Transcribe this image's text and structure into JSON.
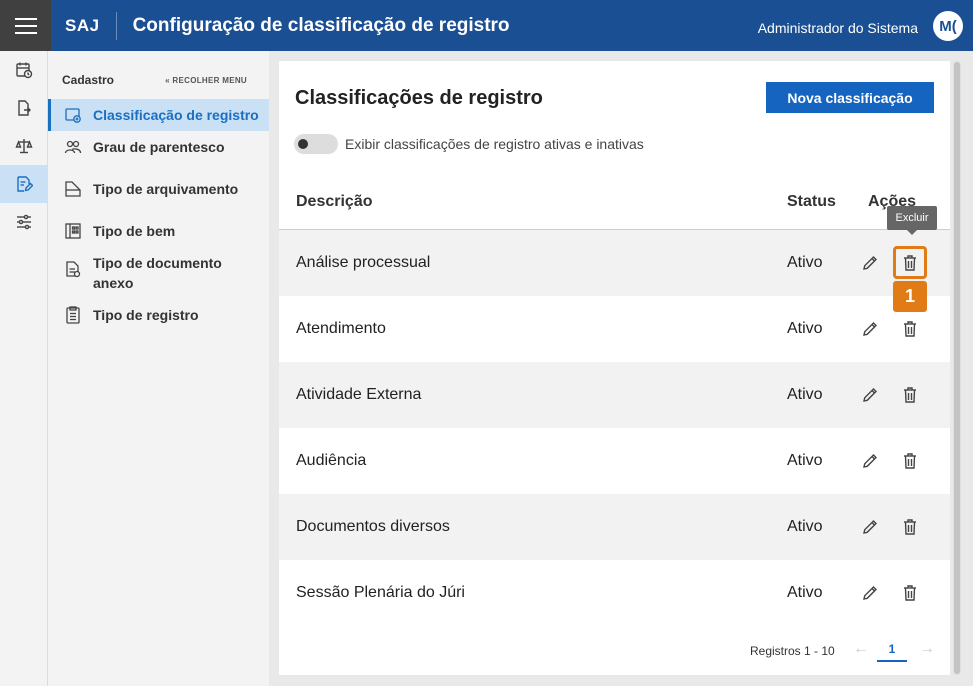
{
  "header": {
    "brand": "SAJ",
    "title": "Configuração de classificação de registro",
    "user": "Administrador do Sistema",
    "avatar": "M("
  },
  "rail": {
    "items": [
      {
        "icon": "calendar-clock-icon"
      },
      {
        "icon": "document-share-icon"
      },
      {
        "icon": "scale-icon"
      },
      {
        "icon": "edit-document-icon",
        "active": true
      },
      {
        "icon": "sliders-icon"
      }
    ]
  },
  "sidemenu": {
    "title": "Cadastro",
    "collapse_label": "RECOLHER MENU",
    "collapse_icon": "double-chevron-left-icon",
    "items": [
      {
        "label": "Classificação de registro",
        "icon": "folder-add-icon",
        "active": true
      },
      {
        "label": "Grau de parentesco",
        "icon": "people-icon"
      },
      {
        "label": "Tipo de arquivamento",
        "icon": "archive-icon"
      },
      {
        "label": "Tipo de bem",
        "icon": "building-icon"
      },
      {
        "label": "Tipo de documento anexo",
        "icon": "document-attach-icon"
      },
      {
        "label": "Tipo de registro",
        "icon": "clipboard-list-icon"
      }
    ]
  },
  "main": {
    "title": "Classificações de registro",
    "new_button": "Nova classificação",
    "toggle_label": "Exibir classificações de registro ativas e inativas",
    "toggle_on": false,
    "columns": {
      "descricao": "Descrição",
      "status": "Status",
      "acoes": "Ações"
    },
    "rows": [
      {
        "descricao": "Análise processual",
        "status": "Ativo"
      },
      {
        "descricao": "Atendimento",
        "status": "Ativo"
      },
      {
        "descricao": "Atividade Externa",
        "status": "Ativo"
      },
      {
        "descricao": "Audiência",
        "status": "Ativo"
      },
      {
        "descricao": "Documentos diversos",
        "status": "Ativo"
      },
      {
        "descricao": "Sessão Plenária do Júri",
        "status": "Ativo"
      }
    ],
    "tooltip": "Excluir",
    "highlight_badge": "1",
    "pagination": {
      "summary": "Registros 1 - 10",
      "current_page": "1",
      "prev_icon": "arrow-left-icon",
      "next_icon": "arrow-right-icon"
    }
  },
  "colors": {
    "header_bg": "#1b4f93",
    "accent": "#1565c0",
    "active_bg": "#c9e0f5",
    "highlight": "#e07b16"
  }
}
